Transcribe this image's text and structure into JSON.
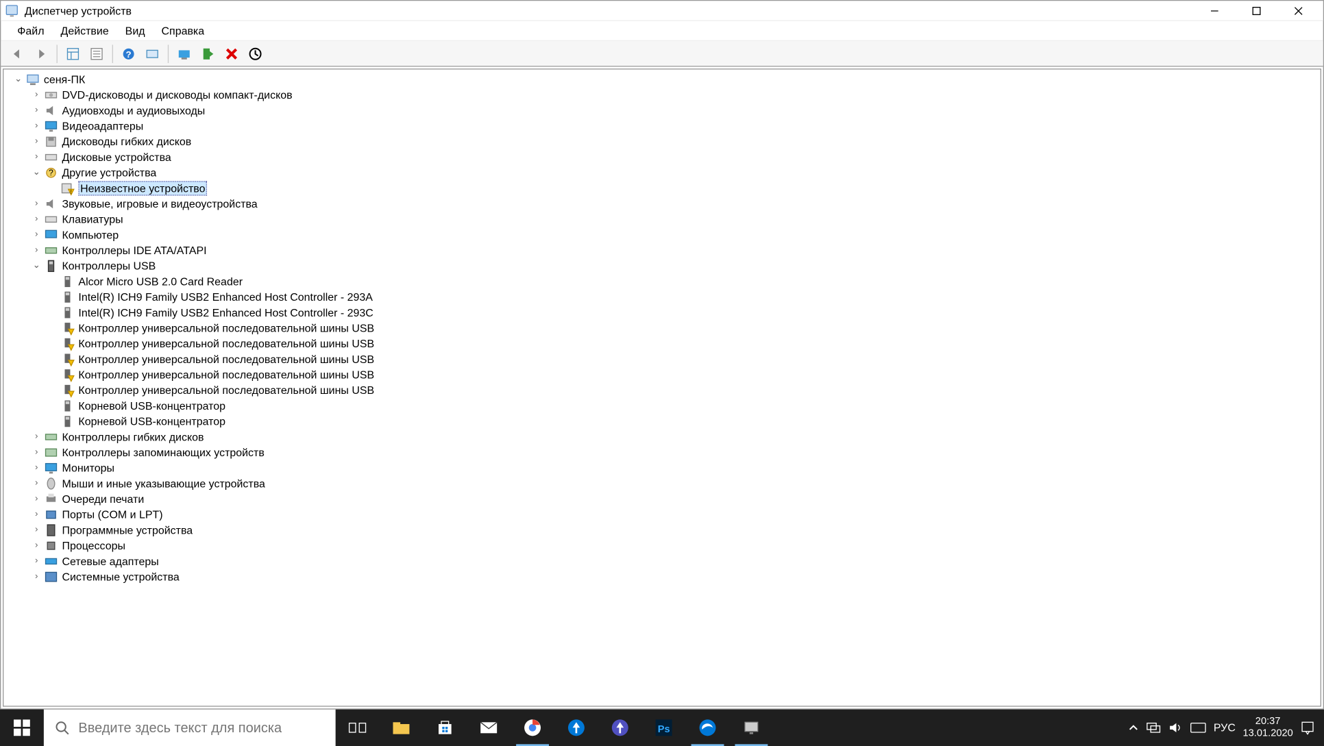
{
  "window": {
    "title": "Диспетчер устройств"
  },
  "menu": {
    "file": "Файл",
    "action": "Действие",
    "view": "Вид",
    "help": "Справка"
  },
  "tree": {
    "root": "сеня-ПК",
    "dvd": "DVD-дисководы и дисководы компакт-дисков",
    "audio_io": "Аудиовходы и аудиовыходы",
    "video_adapters": "Видеоадаптеры",
    "floppy_drives": "Дисководы гибких дисков",
    "disk_drives": "Дисковые устройства",
    "other_devices": "Другие устройства",
    "unknown_device": "Неизвестное устройство",
    "sound_game_video": "Звуковые, игровые и видеоустройства",
    "keyboards": "Клавиатуры",
    "computer": "Компьютер",
    "ide_atapi": "Контроллеры IDE ATA/ATAPI",
    "usb_controllers": "Контроллеры USB",
    "usb_items": {
      "alcor": "Alcor Micro USB 2.0 Card Reader",
      "intel_293a": "Intel(R) ICH9 Family USB2 Enhanced Host Controller - 293A",
      "intel_293c": "Intel(R) ICH9 Family USB2 Enhanced Host Controller - 293C",
      "usb_bus_1": "Контроллер универсальной последовательной шины USB",
      "usb_bus_2": "Контроллер универсальной последовательной шины USB",
      "usb_bus_3": "Контроллер универсальной последовательной шины USB",
      "usb_bus_4": "Контроллер универсальной последовательной шины USB",
      "usb_bus_5": "Контроллер универсальной последовательной шины USB",
      "root_hub_1": "Корневой USB-концентратор",
      "root_hub_2": "Корневой USB-концентратор"
    },
    "floppy_controllers": "Контроллеры гибких дисков",
    "storage_controllers": "Контроллеры запоминающих устройств",
    "monitors": "Мониторы",
    "mice": "Мыши и иные указывающие устройства",
    "print_queues": "Очереди печати",
    "ports": "Порты (COM и LPT)",
    "software_devices": "Программные устройства",
    "processors": "Процессоры",
    "network_adapters": "Сетевые адаптеры",
    "system_devices": "Системные устройства"
  },
  "taskbar": {
    "search_placeholder": "Введите здесь текст для поиска",
    "lang": "РУС",
    "time": "20:37",
    "date": "13.01.2020"
  }
}
